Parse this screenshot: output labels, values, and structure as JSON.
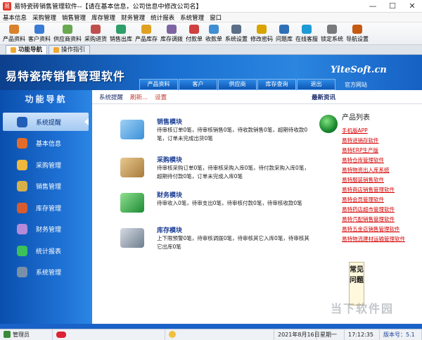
{
  "window": {
    "title": "易特瓷砖销售管理软件--【请在基本信息，公司信息中修改公司名】",
    "min_glyph": "—",
    "max_glyph": "☐",
    "close_glyph": "✕"
  },
  "menu": [
    "基本信息",
    "采购管理",
    "销售管理",
    "库存管理",
    "财务管理",
    "统计报表",
    "系统管理",
    "窗口"
  ],
  "toolbar": [
    {
      "label": "产品资料",
      "icon": "product-icon",
      "color": "#d9822b"
    },
    {
      "label": "客户资料",
      "icon": "customer-icon",
      "color": "#3a7bd5"
    },
    {
      "label": "供应商资料",
      "icon": "supplier-icon",
      "color": "#6aa84f"
    },
    {
      "label": "采购进货",
      "icon": "purchase-icon",
      "color": "#c0504d"
    },
    {
      "label": "销售出库",
      "icon": "sales-out-icon",
      "color": "#2e9e6a"
    },
    {
      "label": "产品库存",
      "icon": "inventory-icon",
      "color": "#e0a020"
    },
    {
      "label": "库存调拨",
      "icon": "transfer-icon",
      "color": "#8064a2"
    },
    {
      "label": "付款单",
      "icon": "payment-icon",
      "color": "#d04040"
    },
    {
      "label": "收款单",
      "icon": "receipt-icon",
      "color": "#3f8fd2"
    },
    {
      "label": "系统设置",
      "icon": "settings-icon",
      "color": "#5b6f88"
    },
    {
      "label": "修改密码",
      "icon": "password-icon",
      "color": "#d9a300"
    },
    {
      "label": "问题库",
      "icon": "faq-icon",
      "color": "#2f6fb8"
    },
    {
      "label": "在线客服",
      "icon": "support-icon",
      "color": "#1c9bd6"
    },
    {
      "label": "锁定系统",
      "icon": "lock-icon",
      "color": "#7a7a7a"
    },
    {
      "label": "导航设置",
      "icon": "nav-settings-icon",
      "color": "#c55a11"
    }
  ],
  "tabs": [
    {
      "label": "功能导航",
      "active": true
    },
    {
      "label": "操作指引",
      "active": false
    }
  ],
  "banner": {
    "brand": "易特瓷砖销售管理软件",
    "logo": "YiteSoft.cn",
    "home": "官方网站",
    "nav": [
      "产品资料",
      "客户",
      "供应商",
      "库存查询",
      "退出"
    ]
  },
  "sidebar": {
    "title": "功能导航",
    "items": [
      {
        "label": "系统提醒",
        "active": true,
        "icon": "info-icon",
        "color": "#1f5fb8"
      },
      {
        "label": "基本信息",
        "active": false,
        "icon": "basic-info-icon",
        "color": "#e36c2a"
      },
      {
        "label": "采购管理",
        "active": false,
        "icon": "purchase-icon",
        "color": "#f0b83c"
      },
      {
        "label": "销售管理",
        "active": false,
        "icon": "sales-icon",
        "color": "#d8b04b"
      },
      {
        "label": "库存管理",
        "active": false,
        "icon": "inventory-icon",
        "color": "#d65c2f"
      },
      {
        "label": "财务管理",
        "active": false,
        "icon": "finance-icon",
        "color": "#b58ad8"
      },
      {
        "label": "统计报表",
        "active": false,
        "icon": "report-icon",
        "color": "#3cc05a"
      },
      {
        "label": "系统管理",
        "active": false,
        "icon": "system-icon",
        "color": "#7a8fa8"
      }
    ]
  },
  "content": {
    "reminder_title": "系统提醒",
    "refresh": "刷新...",
    "settings": "设置",
    "news": "最新资讯",
    "modules": [
      {
        "title": "销售模块",
        "desc": "待审核订单0笔，待审核销售0笔，待收款销售0笔，超期待收款0笔，订单未完成出货0笔",
        "color": "#5aa8e8"
      },
      {
        "title": "采购模块",
        "desc": "待审核采购订单0笔，待审核采购入库0笔，待付款采购入库0笔，超期待付款0笔，订单未完成入库0笔",
        "color": "#c8a060"
      },
      {
        "title": "财务模块",
        "desc": "待审收入0笔，待审支出0笔，待审核付款0笔，待审核收款0笔",
        "color": "#33a84a"
      },
      {
        "title": "库存模块",
        "desc": "上下限预警0笔，待审核调拨0笔，待审核其它入库0笔，待审核其它出库0笔",
        "color": "#8a98a8"
      }
    ],
    "product_list_title": "产品列表",
    "products": [
      "手机版APP",
      "易特进销存软件",
      "易特ERP生产版",
      "易特仓库管理软件",
      "易特物资出入库系统",
      "易特服装销售软件",
      "易特商店销售管理软件",
      "易特会员管理软件",
      "易特药店超市管理软件",
      "易特汽配销售管理软件",
      "易特五金店销售管理软件",
      "易特物流建材运输管理软件"
    ],
    "faq": "常见问题"
  },
  "status": {
    "user": "管理员",
    "date": "2021年8月16日",
    "weekday": "星期一",
    "time": "17:12:35",
    "version": "版本号：5.1",
    "watermark": "当下软件园"
  }
}
